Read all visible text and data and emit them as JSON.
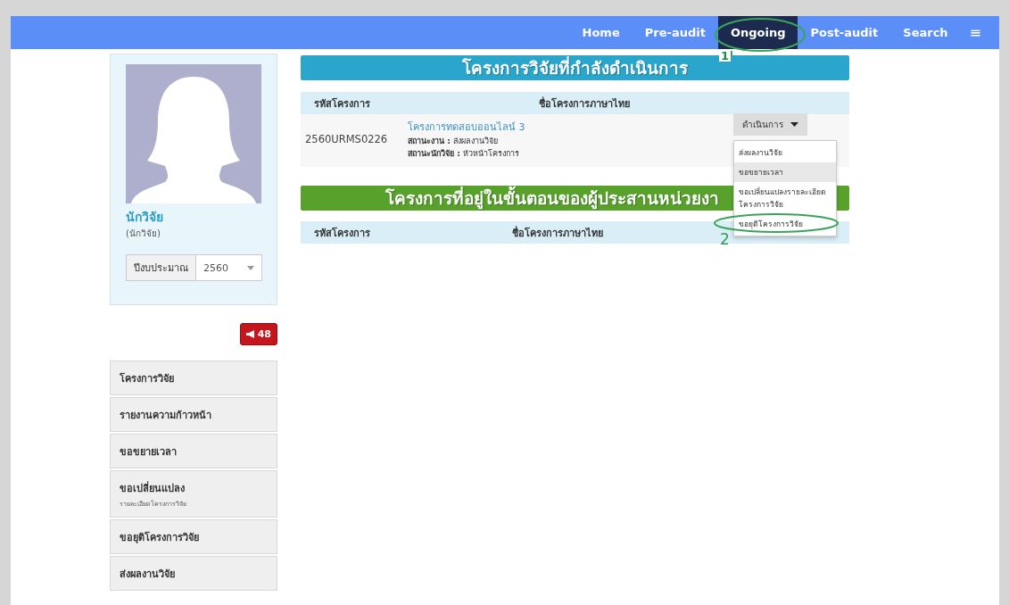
{
  "nav": {
    "items": [
      {
        "label": "Home",
        "selected": false
      },
      {
        "label": "Pre-audit",
        "selected": false
      },
      {
        "label": "Ongoing",
        "selected": true
      },
      {
        "label": "Post-audit",
        "selected": false
      },
      {
        "label": "Search",
        "selected": false
      }
    ],
    "menu_glyph": "≡"
  },
  "profile": {
    "name": "นักวิจัย",
    "role": "(นักวิจัย)",
    "budget_year": {
      "label": "ปีงบประมาณ",
      "value": "2560"
    }
  },
  "notification": {
    "count": "48"
  },
  "side_menu": [
    {
      "label": "โครงการวิจัย"
    },
    {
      "label": "รายงานความก้าวหน้า"
    },
    {
      "label": "ขอขยายเวลา"
    },
    {
      "label": "ขอเปลี่ยนแปลง",
      "sublabel": "รายละเอียดโครงการวิจัย"
    },
    {
      "label": "ขอยุติโครงการวิจัย"
    },
    {
      "label": "ส่งผลงานวิจัย"
    }
  ],
  "ongoing": {
    "title": "โครงการวิจัยที่กำลังดำเนินการ",
    "columns": [
      "รหัสโครงการ",
      "ชื่อโครงการภาษาไทย"
    ],
    "rows": [
      {
        "code": "2560URMS0226",
        "name": "โครงการทดสอบออนไลน์ 3",
        "job_status": "**สถานะงาน :** ส่งผลงานวิจัย",
        "researcher_status": "**สถานะนักวิจัย :** หัวหน้าโครงการ"
      }
    ],
    "action": {
      "label": "ดำเนินการ",
      "menu": [
        {
          "label": "ส่งผลงานวิจัย",
          "selected": false
        },
        {
          "label": "ขอขยายเวลา",
          "selected": true
        },
        {
          "label": "ขอเปลี่ยนแปลงรายละเอียดโครงการวิจัย",
          "selected": false
        },
        {
          "label": "ขอยุติโครงการวิจัย",
          "selected": false
        }
      ]
    }
  },
  "coordinator": {
    "title": "โครงการที่อยู่ในขั้นตอนของผู้ประสานหน่วยงา",
    "columns": [
      "รหัสโครงการ",
      "ชื่อโครงการภาษาไทย"
    ]
  },
  "annotations": [
    {
      "number": "1"
    },
    {
      "number": "2"
    }
  ]
}
